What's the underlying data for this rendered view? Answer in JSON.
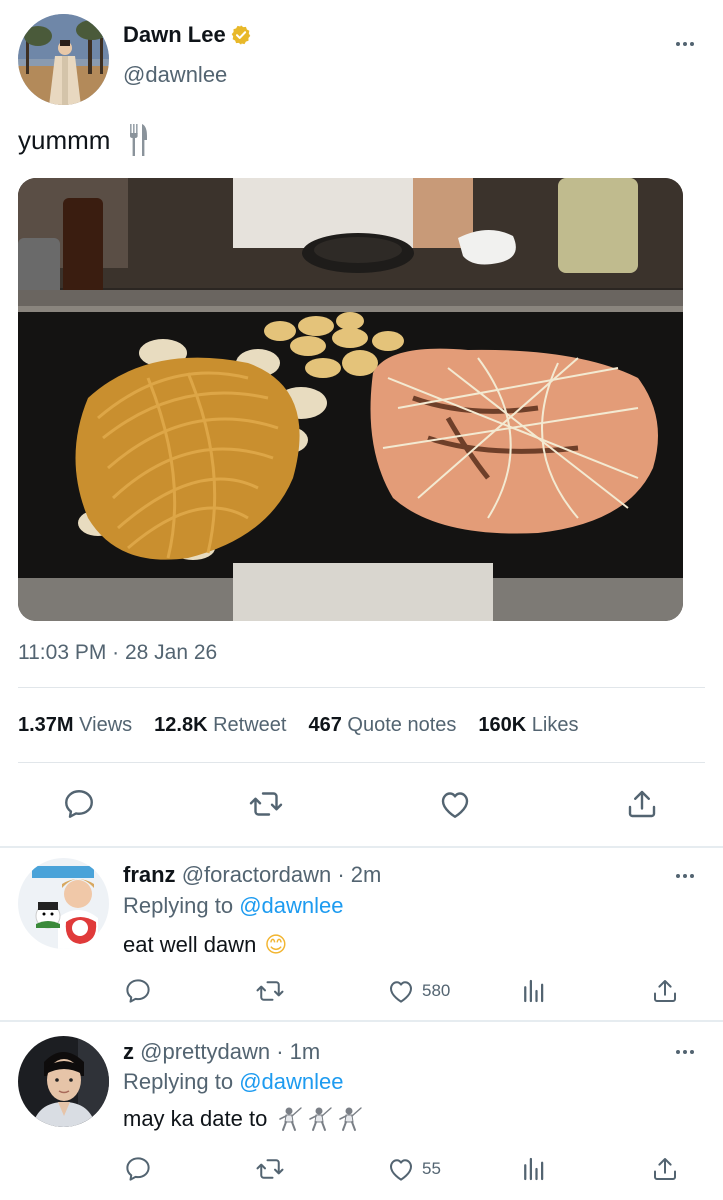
{
  "tweet": {
    "author": {
      "display_name": "Dawn Lee",
      "handle": "@dawnlee",
      "verified": true
    },
    "text": "yummm",
    "emoji_icon": "fork-and-knife",
    "timestamp": "11:03 PM · 28 Jan 26",
    "stats": {
      "views_value": "1.37M",
      "views_label": "Views",
      "retweets_value": "12.8K",
      "retweets_label": "Retweet",
      "quotes_value": "467",
      "quotes_label": "Quote notes",
      "likes_value": "160K",
      "likes_label": "Likes"
    },
    "actions": [
      "reply-icon",
      "retweet-icon",
      "like-icon",
      "share-icon"
    ]
  },
  "replies": [
    {
      "display_name": "franz",
      "handle": "@foractordawn",
      "time": "· 2m",
      "replying_prefix": "Replying to",
      "replying_to": "@dawnlee",
      "text": "eat well dawn",
      "emoji": "😊",
      "likes": "580"
    },
    {
      "display_name": "z",
      "handle": "@prettydawn",
      "time": "· 1m",
      "replying_prefix": "Replying to",
      "replying_to": "@dawnlee",
      "text": "may ka date to",
      "emoji_icon": "fencer",
      "likes": "55"
    }
  ],
  "colors": {
    "text_primary": "#0f1419",
    "text_secondary": "#536471",
    "link": "#1d9bf0",
    "verified_badge": "#e8b829",
    "divider": "#e1e6ea"
  }
}
